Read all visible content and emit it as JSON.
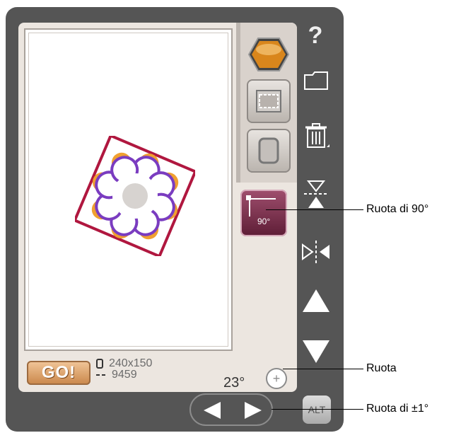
{
  "status_bar": {
    "go_label": "GO!",
    "hoop_size": "240x150",
    "stitch_count": "9459",
    "rotation_value": "23°"
  },
  "sidebar": {
    "help_label": "?"
  },
  "bottom": {
    "alt_label": "ALT"
  },
  "tool_panel": {
    "rotate_90_label": "90°"
  },
  "callouts": {
    "rotate_90": "Ruota di 90°",
    "rotate": "Ruota",
    "rotate_step": "Ruota di ±1°"
  },
  "icons": {
    "help": "question-mark-icon",
    "folder": "folder-icon",
    "trash": "trash-icon",
    "mirror_vertical": "mirror-vertical-icon",
    "mirror_horizontal": "mirror-horizontal-icon",
    "up": "arrow-up-icon",
    "down": "arrow-down-icon",
    "left": "arrow-left-icon",
    "right": "arrow-right-icon",
    "rotate_handle": "rotate-handle-icon"
  },
  "colors": {
    "device": "#555555",
    "screen": "#ece6e0",
    "accent_rotate90": "#7b2a4a",
    "go_button": "#d89a5e",
    "design_frame": "#b0173f",
    "design_purple": "#7a3cc0",
    "design_orange": "#f0a030"
  }
}
